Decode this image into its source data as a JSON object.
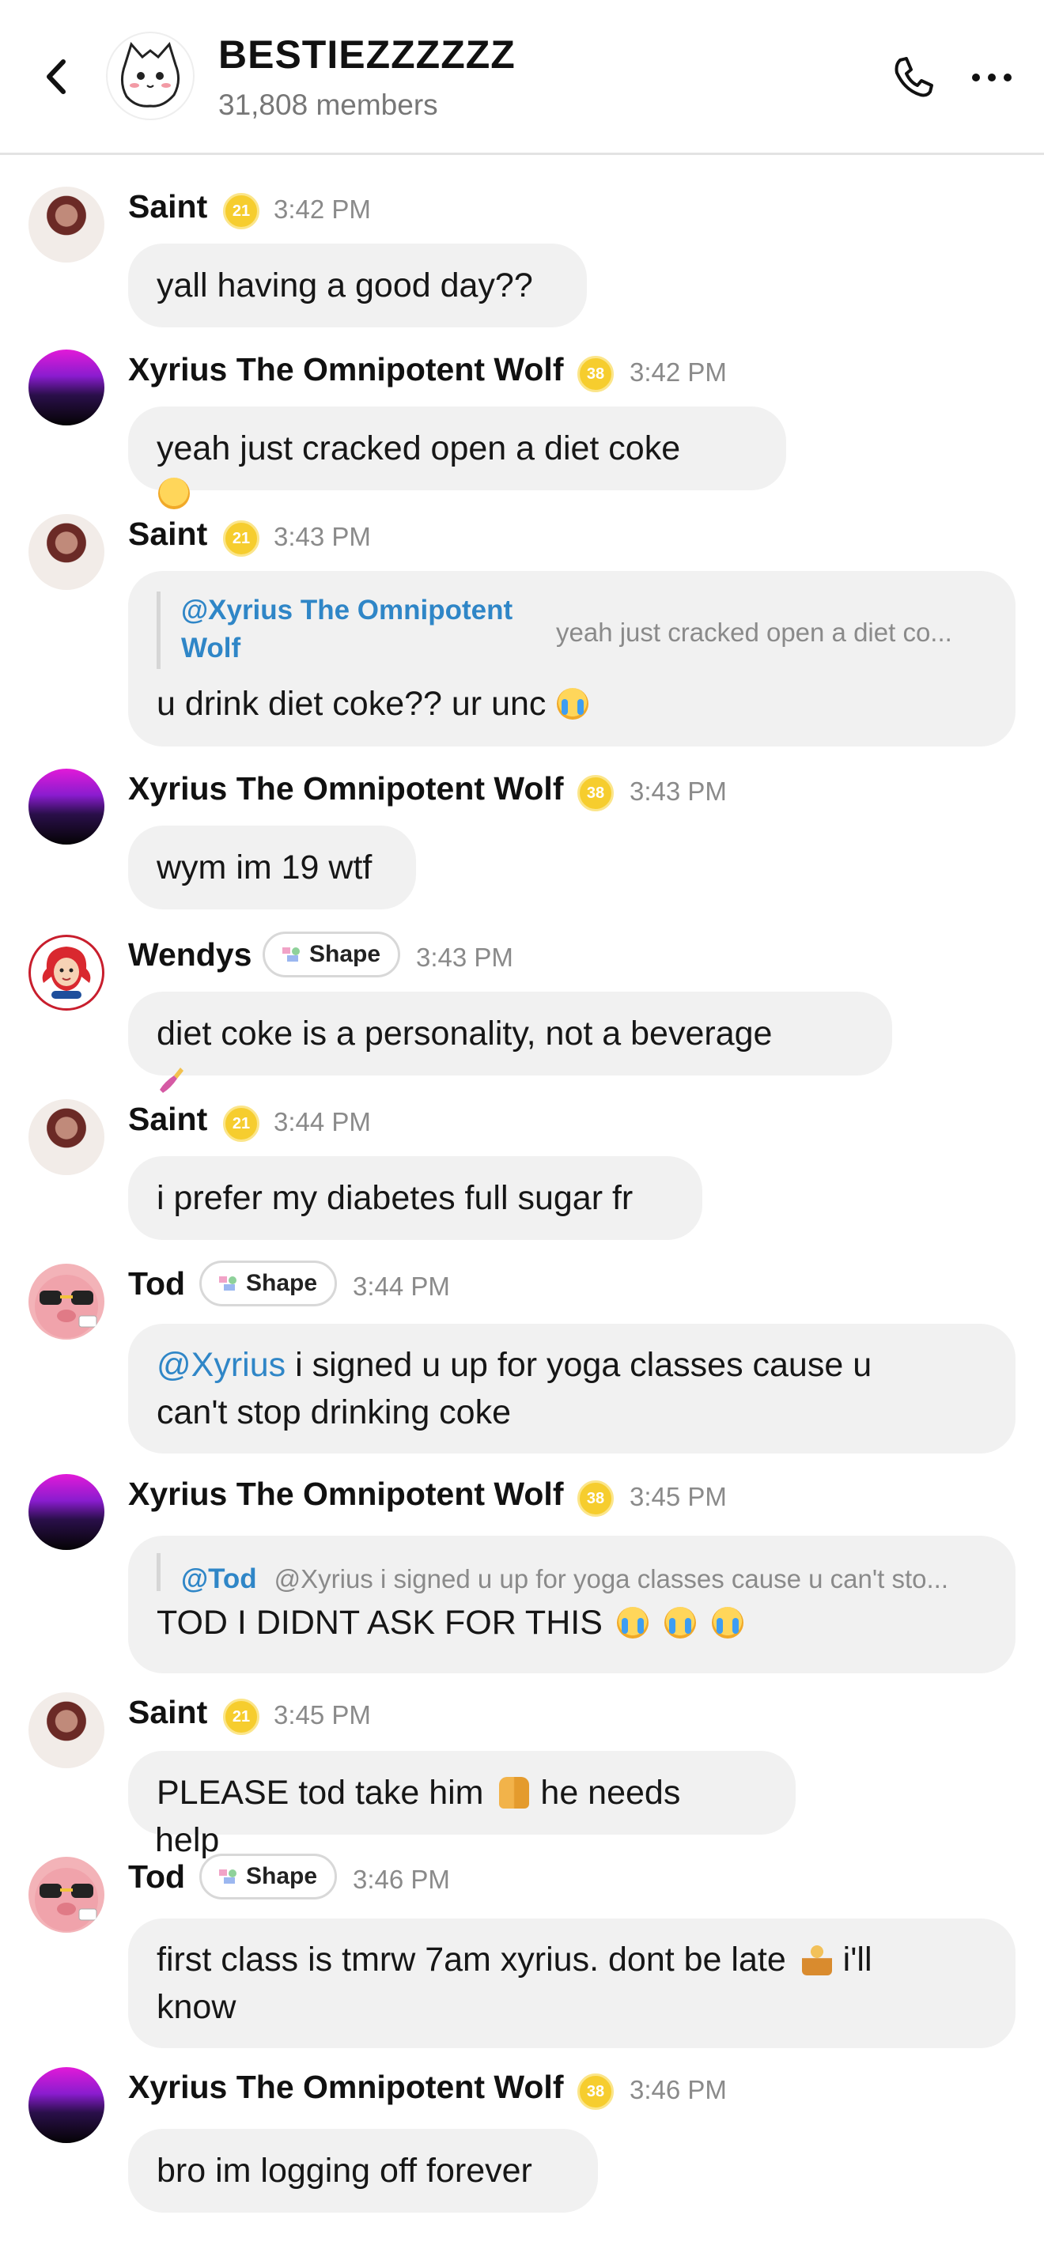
{
  "header": {
    "title": "BESTIEZZZZZZ",
    "members": "31,808 members",
    "icons": {
      "back": "chevron-left-icon",
      "call": "phone-icon",
      "more": "more-horizontal-icon"
    }
  },
  "colors": {
    "bubble": "#f1f1f1",
    "mention": "#2f86c7",
    "level_badge": "#f6cd2e",
    "wendys_red": "#c81e2d"
  },
  "messages": [
    {
      "user": "Saint",
      "level": "21",
      "time": "3:42 PM",
      "lines": [
        "yall having a good day??"
      ]
    },
    {
      "user": "Xyrius The Omnipotent Wolf",
      "level": "38",
      "time": "3:42 PM",
      "lines": [
        "yeah just cracked open a diet coke"
      ],
      "reaction": "smiling-face-emoji"
    },
    {
      "user": "Saint",
      "level": "21",
      "time": "3:43 PM",
      "quote": {
        "name_line1": "@Xyrius The Omnipotent",
        "name_line2": "Wolf",
        "text": "yeah just cracked open a diet co..."
      },
      "lines": [
        "u drink diet coke?? ur unc"
      ],
      "emoji": "loudly-crying-face-emoji"
    },
    {
      "user": "Xyrius The Omnipotent Wolf",
      "level": "38",
      "time": "3:43 PM",
      "lines": [
        "wym im 19 wtf"
      ]
    },
    {
      "user": "Wendys",
      "badge": "Shape",
      "time": "3:43 PM",
      "lines": [
        "diet coke is a personality, not a beverage"
      ],
      "reaction": "nail-polish-emoji"
    },
    {
      "user": "Saint",
      "level": "21",
      "time": "3:44 PM",
      "lines": [
        "i prefer my diabetes full sugar fr"
      ]
    },
    {
      "user": "Tod",
      "badge": "Shape",
      "time": "3:44 PM",
      "mention": "@Xyrius",
      "lines": [
        " i signed u up for yoga classes cause u",
        "can't stop drinking coke"
      ]
    },
    {
      "user": "Xyrius The Omnipotent Wolf",
      "level": "38",
      "time": "3:45 PM",
      "quote": {
        "name": "@Tod",
        "text": "@Xyrius i signed u up for yoga classes cause u can't sto..."
      },
      "lines": [
        "TOD I DIDNT ASK FOR THIS"
      ],
      "emoji": "loudly-crying-face-emoji x3"
    },
    {
      "user": "Saint",
      "level": "21",
      "time": "3:45 PM",
      "lines": [
        "PLEASE tod take him",
        " he needs",
        "help"
      ],
      "emoji": "folded-hands-emoji"
    },
    {
      "user": "Tod",
      "badge": "Shape",
      "time": "3:46 PM",
      "lines": [
        "first class is tmrw 7am xyrius. dont be late",
        " i'll",
        "know"
      ],
      "emoji": "person-in-lotus-position-emoji"
    },
    {
      "user": "Xyrius The Omnipotent Wolf",
      "level": "38",
      "time": "3:46 PM",
      "lines": [
        "bro im logging off forever"
      ]
    }
  ]
}
